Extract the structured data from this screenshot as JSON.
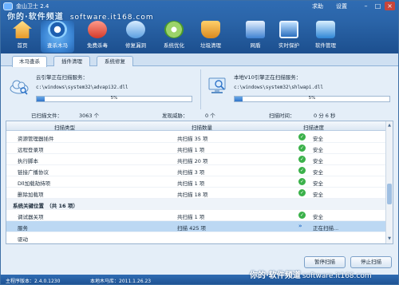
{
  "app": {
    "title": "金山卫士 2.4",
    "title_links": [
      "求助",
      "设置"
    ],
    "window_buttons": [
      "minimize",
      "maximize",
      "close"
    ]
  },
  "watermark_top": {
    "text": "你的·软件频道",
    "url": "software.it168.com"
  },
  "watermark_bottom": {
    "text": "你的·软件频道",
    "url": "software.it168.com"
  },
  "nav": [
    {
      "label": "首页",
      "icon": "home-icon"
    },
    {
      "label": "查杀木马",
      "icon": "trojan-scan-icon"
    },
    {
      "label": "免费杀毒",
      "icon": "antivirus-icon"
    },
    {
      "label": "修复漏洞",
      "icon": "patch-icon"
    },
    {
      "label": "系统优化",
      "icon": "optimize-icon"
    },
    {
      "label": "垃圾清理",
      "icon": "cleanup-icon"
    },
    {
      "label": "网盾",
      "icon": "web-shield-icon"
    },
    {
      "label": "实时保护",
      "icon": "realtime-protect-icon"
    },
    {
      "label": "软件管理",
      "icon": "software-manager-icon"
    }
  ],
  "tabs": [
    {
      "label": "木马查杀"
    },
    {
      "label": "插件清理"
    },
    {
      "label": "系统修复"
    }
  ],
  "scan": {
    "cloud": {
      "title": "云引擎正在扫描服务：",
      "file": "c:\\windows\\system32\\advapi32.dll",
      "progress": "5%",
      "progress_value": 5
    },
    "local": {
      "title": "本地V10引擎正在扫描服务：",
      "file": "c:\\windows\\system32\\shlwapi.dll",
      "progress": "5%",
      "progress_value": 5
    }
  },
  "stats": {
    "scanned_label": "已扫描文件：",
    "scanned_value": "3063 个",
    "threats_label": "发现威胁：",
    "threats_value": "0 个",
    "time_label": "扫描时间：",
    "time_value": "0 分 6 秒"
  },
  "table": {
    "headers": [
      "扫描类型",
      "扫描数量",
      "扫描进度"
    ],
    "rows": [
      {
        "type": "资源管理器插件",
        "count": "共扫描 35 项",
        "status": "安全",
        "kind": "ok"
      },
      {
        "type": "远程登录项",
        "count": "共扫描 1 项",
        "status": "安全",
        "kind": "ok"
      },
      {
        "type": "执行脚本",
        "count": "共扫描 20 项",
        "status": "安全",
        "kind": "ok"
      },
      {
        "type": "链接广播协议",
        "count": "共扫描 3 项",
        "status": "安全",
        "kind": "ok"
      },
      {
        "type": "Dll加载劫持项",
        "count": "共扫描 1 项",
        "status": "安全",
        "kind": "ok"
      },
      {
        "type": "删除加载项",
        "count": "共扫描 18 项",
        "status": "安全",
        "kind": "ok"
      },
      {
        "type": "系统关键位置　（共 16 项）",
        "count": "",
        "status": "",
        "kind": "group"
      },
      {
        "type": "调试器关项",
        "count": "共扫描 1 项",
        "status": "安全",
        "kind": "ok"
      },
      {
        "type": "服务",
        "count": "扫描 425 项",
        "status": "正在扫描...",
        "kind": "scanning"
      },
      {
        "type": "驱动",
        "count": "",
        "status": "",
        "kind": "pending"
      }
    ]
  },
  "buttons": {
    "pause": "暂停扫描",
    "stop": "停止扫描"
  },
  "status": {
    "version": "主程序版本：2.4.0.1230",
    "db": "本地木马库：2011.1.26.23"
  },
  "colors": {
    "top_bar": "#2a64a8",
    "safe_green": "#3bb14a",
    "selected_row": "#bcd8f3"
  }
}
